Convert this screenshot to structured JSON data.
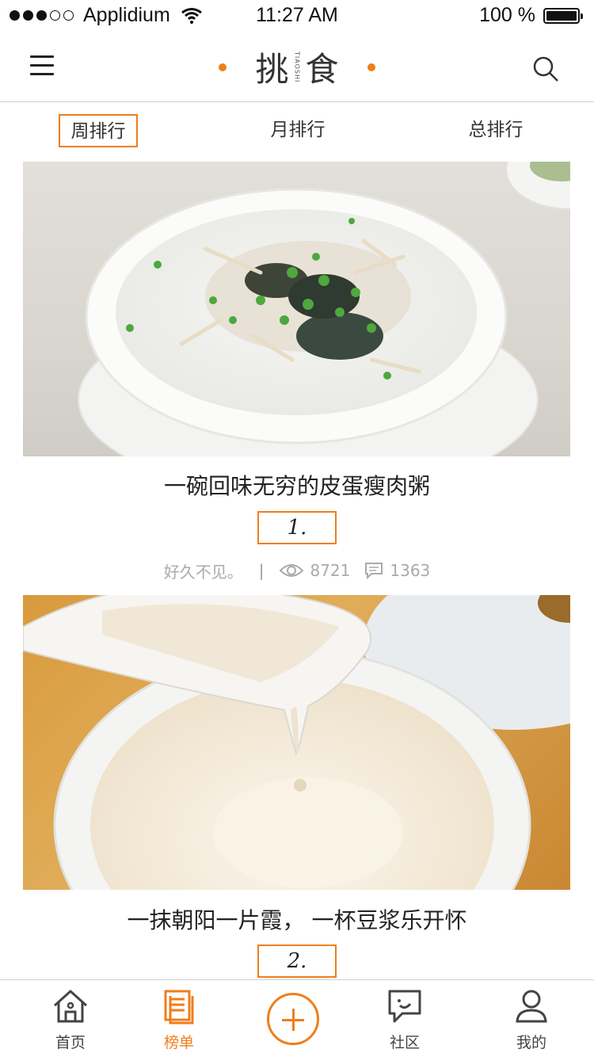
{
  "status_bar": {
    "carrier": "Applidium",
    "time": "11:27 AM",
    "battery": "100 %",
    "signal_bars_filled": 3,
    "signal_bars_total": 5,
    "battery_level": 1.0
  },
  "nav": {
    "logo_left": "挑",
    "logo_right": "食",
    "logo_sub": "TIAOSHI",
    "accent_color": "#f07d1b"
  },
  "tabs": [
    {
      "label": "周排行",
      "active": true
    },
    {
      "label": "月排行",
      "active": false
    },
    {
      "label": "总排行",
      "active": false
    }
  ],
  "items": [
    {
      "title": "一碗回味无穷的皮蛋瘦肉粥",
      "rank": "1.",
      "author": "好久不见。",
      "views": "8721",
      "comments": "1363"
    },
    {
      "title": "一抹朝阳一片霞，  一杯豆浆乐开怀",
      "rank": "2."
    }
  ],
  "tab_bar": [
    {
      "label": "首页",
      "icon": "home-icon",
      "active": false
    },
    {
      "label": "榜单",
      "icon": "list-icon",
      "active": true
    },
    {
      "label": "",
      "icon": "plus-icon",
      "active": false
    },
    {
      "label": "社区",
      "icon": "chat-icon",
      "active": false
    },
    {
      "label": "我的",
      "icon": "user-icon",
      "active": false
    }
  ]
}
